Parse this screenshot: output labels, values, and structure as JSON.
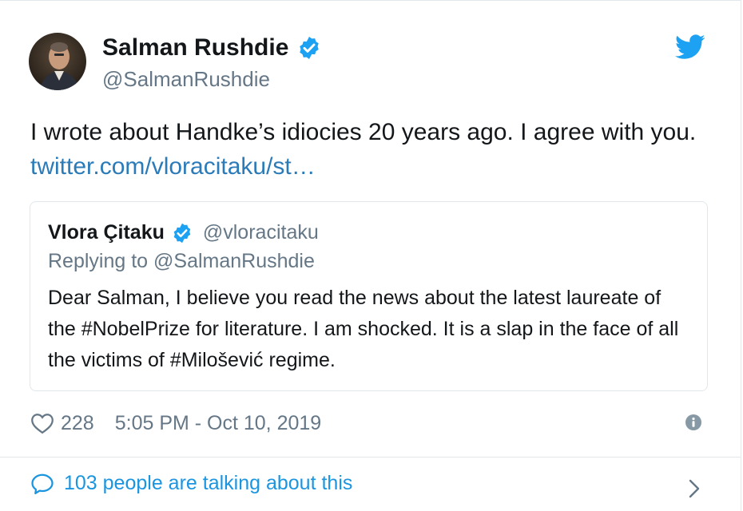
{
  "author": {
    "name": "Salman Rushdie",
    "handle": "@SalmanRushdie",
    "verified": true
  },
  "tweet": {
    "text": "I wrote about Handke’s idiocies 20 years ago. I agree with you. ",
    "link_text": "twitter.com/vloracitaku/st…"
  },
  "quoted": {
    "name": "Vlora Çitaku",
    "handle": "@vloracitaku",
    "replying_to": "Replying to @SalmanRushdie",
    "text": "Dear Salman, I believe you read the news about the latest laureate of the #NobelPrize for literature. I am shocked. It is a slap in the face of all the victims of #Milošević regime."
  },
  "meta": {
    "likes": "228",
    "timestamp": "5:05 PM - Oct 10, 2019"
  },
  "footer": {
    "talking": "103 people are talking about this"
  },
  "colors": {
    "link": "#2b7bb9",
    "verified": "#1da1f2",
    "twitter_blue": "#1da1f2",
    "secondary_text": "#657786",
    "border": "#e1e8ed"
  },
  "icons": [
    "verified-icon",
    "twitter-bird-icon",
    "heart-icon",
    "info-icon",
    "speech-bubble-icon",
    "chevron-right-icon"
  ]
}
